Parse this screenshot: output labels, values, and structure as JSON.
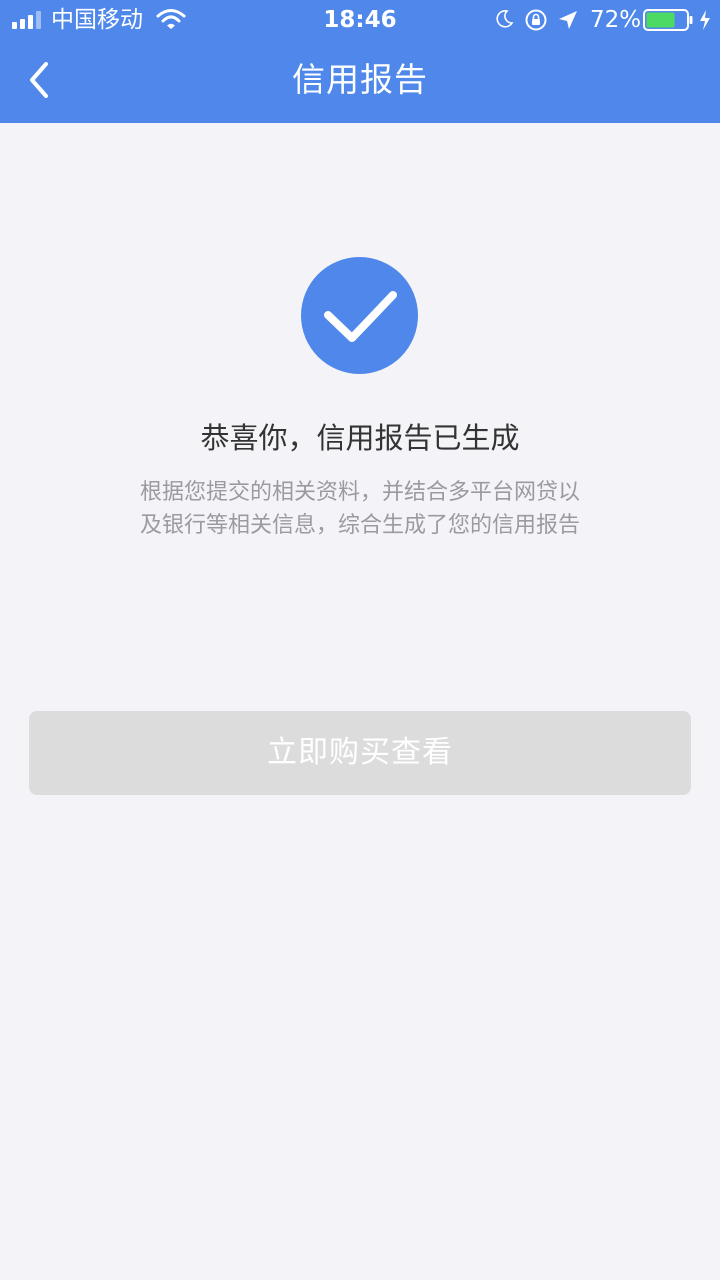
{
  "status_bar": {
    "carrier": "中国移动",
    "time": "18:46",
    "battery_percent": "72%",
    "battery_level": 0.72,
    "icons": [
      "signal-icon",
      "wifi-icon",
      "moon-icon",
      "rotation-lock-icon",
      "location-arrow-icon",
      "battery-icon",
      "charging-bolt-icon"
    ]
  },
  "nav": {
    "title": "信用报告",
    "back_icon": "chevron-left-icon"
  },
  "result": {
    "icon": "check-circle-icon",
    "headline": "恭喜你，信用报告已生成",
    "description_line1": "根据您提交的相关资料，并结合多平台网贷以",
    "description_line2": "及银行等相关信息，综合生成了您的信用报告"
  },
  "actions": {
    "buy_label": "立即购买查看"
  },
  "colors": {
    "accent": "#4f88ea",
    "background": "#f4f3f7",
    "button_disabled": "#dcdcdc",
    "headline_text": "#333333",
    "description_text": "#9b9b9f",
    "battery_fill": "#4cd964"
  }
}
